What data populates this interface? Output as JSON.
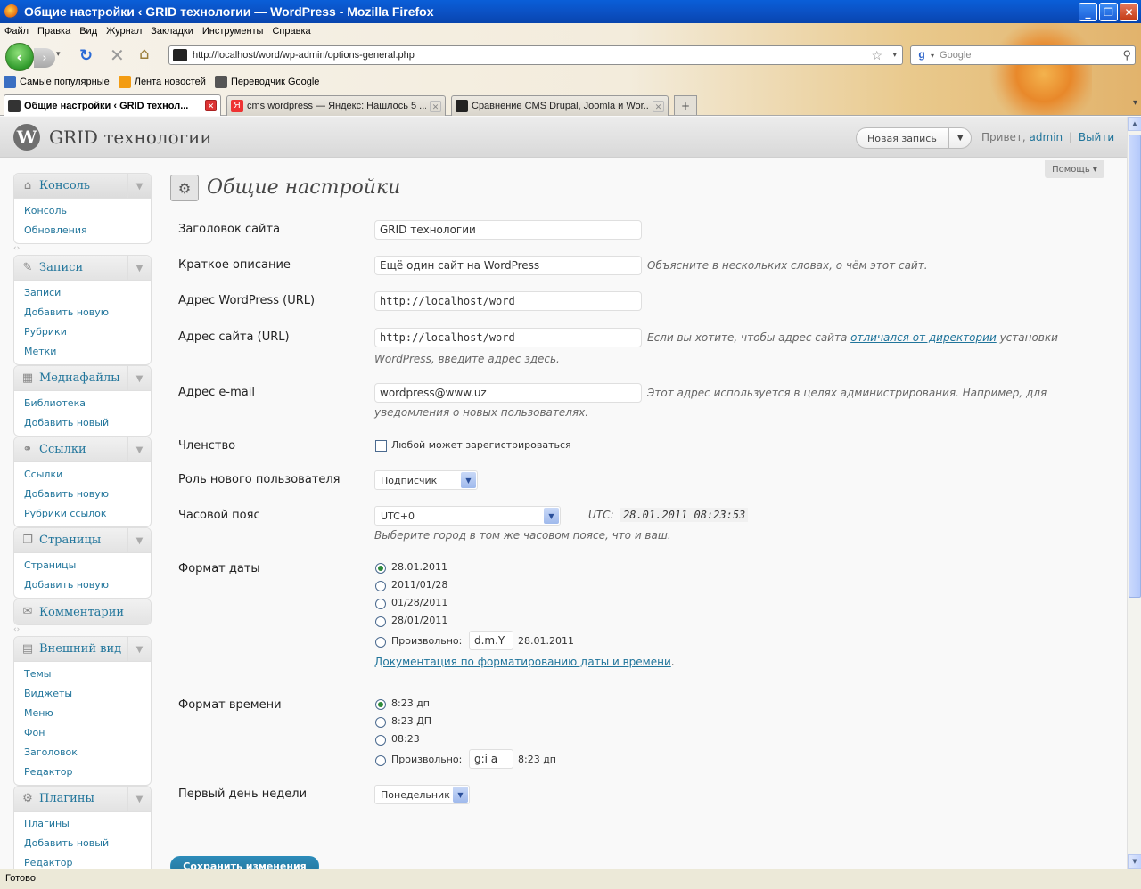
{
  "window": {
    "title": "Общие настройки ‹ GRID технологии — WordPress - Mozilla Firefox",
    "minimize": "_",
    "maximize": "❐",
    "close": "✕"
  },
  "menubar": [
    "Файл",
    "Правка",
    "Вид",
    "Журнал",
    "Закладки",
    "Инструменты",
    "Справка"
  ],
  "navbar": {
    "url": "http://localhost/word/wp-admin/options-general.php",
    "search_placeholder": "Google"
  },
  "bookmarks": [
    {
      "label": "Самые популярные",
      "color": "#3b6fc2"
    },
    {
      "label": "Лента новостей",
      "color": "#f39c12"
    },
    {
      "label": "Переводчик Google",
      "color": "#555555"
    }
  ],
  "tabs": [
    {
      "label": "Общие настройки ‹ GRID технол...",
      "active": true
    },
    {
      "label": "cms wordpress — Яндекс: Нашлось 5 ...",
      "active": false
    },
    {
      "label": "Сравнение CMS Drupal, Joomla и Wor...",
      "active": false
    }
  ],
  "wp_header": {
    "site_title": "GRID технологии",
    "new_post": "Новая запись",
    "greeting": "Привет,",
    "user": "admin",
    "separator": "|",
    "logout": "Выйти",
    "help": "Помощь ▾"
  },
  "admin_menu": [
    {
      "label": "Консоль",
      "icon": "home-icon",
      "glyph": "⌂",
      "items": [
        "Консоль",
        "Обновления"
      ]
    },
    {
      "label": "Записи",
      "icon": "pin-icon",
      "glyph": "✎",
      "items": [
        "Записи",
        "Добавить новую",
        "Рубрики",
        "Метки"
      ]
    },
    {
      "label": "Медиафайлы",
      "icon": "media-icon",
      "glyph": "▦",
      "items": [
        "Библиотека",
        "Добавить новый"
      ]
    },
    {
      "label": "Ссылки",
      "icon": "link-icon",
      "glyph": "⚭",
      "items": [
        "Ссылки",
        "Добавить новую",
        "Рубрики ссылок"
      ]
    },
    {
      "label": "Страницы",
      "icon": "pages-icon",
      "glyph": "❐",
      "items": [
        "Страницы",
        "Добавить новую"
      ]
    },
    {
      "label": "Комментарии",
      "icon": "comments-icon",
      "glyph": "✉",
      "items": []
    },
    {
      "label": "Внешний вид",
      "icon": "appearance-icon",
      "glyph": "▤",
      "items": [
        "Темы",
        "Виджеты",
        "Меню",
        "Фон",
        "Заголовок",
        "Редактор"
      ]
    },
    {
      "label": "Плагины",
      "icon": "plugins-icon",
      "glyph": "⚙",
      "items": [
        "Плагины",
        "Добавить новый",
        "Редактор"
      ]
    }
  ],
  "settings": {
    "page_title": "Общие настройки",
    "site_title_label": "Заголовок сайта",
    "site_title_value": "GRID технологии",
    "tagline_label": "Краткое описание",
    "tagline_value": "Ещё один сайт на WordPress",
    "tagline_desc": "Объясните в нескольких словах, о чём этот сайт.",
    "wp_url_label": "Адрес WordPress (URL)",
    "wp_url_value": "http://localhost/word",
    "site_url_label": "Адрес сайта (URL)",
    "site_url_value": "http://localhost/word",
    "site_url_desc_pre": "Если вы хотите, чтобы адрес сайта",
    "site_url_desc_link": "отличался от директории",
    "site_url_desc_post": "установки",
    "site_url_desc_line2": "WordPress, введите адрес здесь.",
    "email_label": "Адрес e-mail",
    "email_value": "wordpress@www.uz",
    "email_desc_line1": "Этот адрес используется в целях администрирования. Например, для",
    "email_desc_line2": "уведомления о новых пользователях.",
    "membership_label": "Членство",
    "membership_checkbox": "Любой может зарегистрироваться",
    "membership_checked": false,
    "role_label": "Роль нового пользователя",
    "role_value": "Подписчик",
    "timezone_label": "Часовой пояс",
    "timezone_value": "UTC+0",
    "utc_label": "UTC:",
    "utc_time": "28.01.2011 08:23:53",
    "timezone_desc": "Выберите город в том же часовом поясе, что и ваш.",
    "date_format_label": "Формат даты",
    "date_formats": [
      "28.01.2011",
      "2011/01/28",
      "01/28/2011",
      "28/01/2011"
    ],
    "date_selected": 0,
    "custom_label": "Произвольно:",
    "date_custom_value": "d.m.Y",
    "date_custom_sample": "28.01.2011",
    "date_doc_link": "Документация по форматированию даты и времени",
    "date_doc_dot": ".",
    "time_format_label": "Формат времени",
    "time_formats": [
      "8:23 дп",
      "8:23 ДП",
      "08:23"
    ],
    "time_selected": 0,
    "time_custom_value": "g:i a",
    "time_custom_sample": "8:23 дп",
    "week_start_label": "Первый день недели",
    "week_start_value": "Понедельник",
    "save_button": "Сохранить изменения"
  },
  "status": "Готово"
}
